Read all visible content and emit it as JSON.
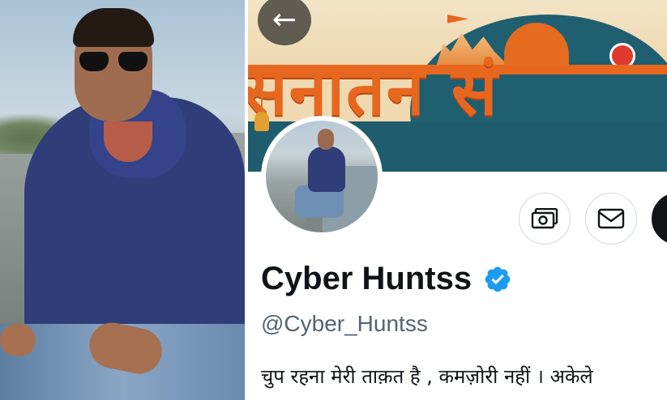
{
  "profile": {
    "display_name": "Cyber Huntss",
    "handle": "@Cyber_Huntss",
    "bio": "चुप रहना मेरी ताक़त है , कमज़ोरी नहीं । अकेले",
    "banner_text": "सनातन सं",
    "verified": true
  },
  "actions": {
    "back_icon": "←"
  },
  "icons": {
    "back": "arrow-left-icon",
    "money": "money-icon",
    "mail": "mail-icon",
    "verified": "verified-badge-icon"
  },
  "colors": {
    "accent_orange": "#e8671f",
    "banner_teal": "#1f5c6e",
    "verified_blue": "#1d9bf0",
    "text_primary": "#0f1419",
    "text_secondary": "#536471"
  }
}
